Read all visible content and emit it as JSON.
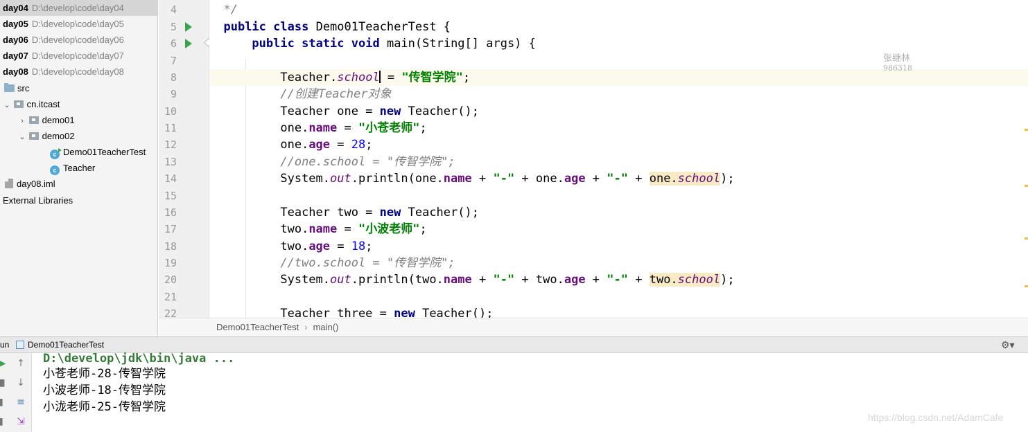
{
  "project_tree": [
    {
      "name": "day04",
      "path": "D:\\develop\\code\\day04",
      "selected": true
    },
    {
      "name": "day05",
      "path": "D:\\develop\\code\\day05"
    },
    {
      "name": "day06",
      "path": "D:\\develop\\code\\day06"
    },
    {
      "name": "day07",
      "path": "D:\\develop\\code\\day07"
    },
    {
      "name": "day08",
      "path": "D:\\develop\\code\\day08"
    },
    {
      "name": "src"
    },
    {
      "name": "cn.itcast"
    },
    {
      "name": "demo01"
    },
    {
      "name": "demo02"
    },
    {
      "name": "Demo01TeacherTest"
    },
    {
      "name": "Teacher"
    },
    {
      "name": "day08.iml"
    },
    {
      "name": "External Libraries"
    }
  ],
  "editor": {
    "line_numbers": [
      "4",
      "5",
      "6",
      "7",
      "8",
      "9",
      "10",
      "11",
      "12",
      "13",
      "14",
      "15",
      "16",
      "17",
      "18",
      "19",
      "20",
      "21",
      "22"
    ],
    "code": {
      "l4": "*/",
      "l5_kw1": "public",
      "l5_kw2": "class",
      "l5_rest": " Demo01TeacherTest {",
      "l6_kw1": "public",
      "l6_kw2": "static",
      "l6_kw3": "void",
      "l6_rest": " main(String[] args) {",
      "l8_a": "Teacher.",
      "l8_field": "school",
      "l8_b": " = ",
      "l8_str": "\"传智学院\"",
      "l8_c": ";",
      "l9_comment": "//创建Teacher对象",
      "l10_a": "Teacher one = ",
      "l10_kw": "new",
      "l10_b": " Teacher();",
      "l11_a": "one.",
      "l11_field": "name",
      "l11_b": " = ",
      "l11_str": "\"小苍老师\"",
      "l11_c": ";",
      "l12_a": "one.",
      "l12_field": "age",
      "l12_b": " = ",
      "l12_num": "28",
      "l12_c": ";",
      "l13_comment": "//one.school = \"传智学院\";",
      "l14_a": "System.",
      "l14_out": "out",
      "l14_b": ".println(one.",
      "l14_name": "name",
      "l14_c": " + ",
      "l14_s1": "\"-\"",
      "l14_d": " + one.",
      "l14_age": "age",
      "l14_e": " + ",
      "l14_s2": "\"-\"",
      "l14_f": " + ",
      "l14_hl_obj": "one.",
      "l14_hl_field": "school",
      "l14_g": ");",
      "l16_a": "Teacher two = ",
      "l16_kw": "new",
      "l16_b": " Teacher();",
      "l17_a": "two.",
      "l17_field": "name",
      "l17_b": " = ",
      "l17_str": "\"小波老师\"",
      "l17_c": ";",
      "l18_a": "two.",
      "l18_field": "age",
      "l18_b": " = ",
      "l18_num": "18",
      "l18_c": ";",
      "l19_comment": "//two.school = \"传智学院\";",
      "l20_a": "System.",
      "l20_out": "out",
      "l20_b": ".println(two.",
      "l20_name": "name",
      "l20_c": " + ",
      "l20_s1": "\"-\"",
      "l20_d": " + two.",
      "l20_age": "age",
      "l20_e": " + ",
      "l20_s2": "\"-\"",
      "l20_f": " + ",
      "l20_hl_obj": "two.",
      "l20_hl_field": "school",
      "l20_g": ");",
      "l22_a": "Teacher three = ",
      "l22_kw": "new",
      "l22_b": " Teacher();"
    },
    "watermark_name": "张继林",
    "watermark_number": "986318"
  },
  "breadcrumb": {
    "file": "Demo01TeacherTest",
    "sep": "›",
    "method": "main()"
  },
  "run_panel": {
    "tab_prefix": "un",
    "tab_label": "Demo01TeacherTest",
    "gear_icon": "gear-icon",
    "console_lines": [
      "D:\\develop\\jdk\\bin\\java ...",
      "小苍老师-28-传智学院",
      "小波老师-18-传智学院",
      "小泷老师-25-传智学院"
    ]
  },
  "footer_watermark": "https://blog.csdn.net/AdamCafe"
}
